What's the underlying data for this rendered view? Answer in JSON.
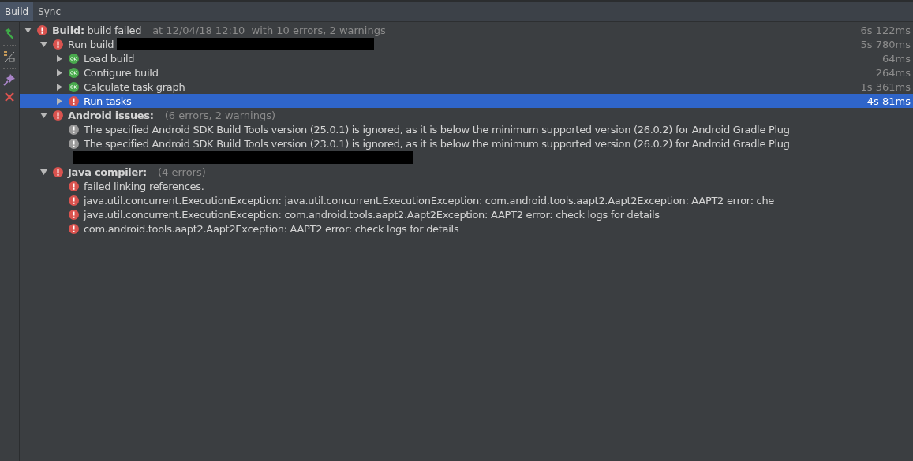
{
  "tabs": [
    {
      "label": "Build",
      "selected": true
    },
    {
      "label": "Sync",
      "selected": false
    }
  ],
  "tree": [
    {
      "label": "**Build:** build failed",
      "detail": "at 12/04/18 12:10  with 10 errors, 2 warnings",
      "kind": "error",
      "expanded": true,
      "selected": false,
      "time": "6s 122ms",
      "children": [
        {
          "label": "Run build",
          "kind": "error",
          "expanded": true,
          "selected": false,
          "redacted": true,
          "time": "5s 780ms",
          "children": [
            {
              "label": "Load build",
              "kind": "ok",
              "expanded": false,
              "selected": false,
              "time": "64ms"
            },
            {
              "label": "Configure build",
              "kind": "ok",
              "expanded": false,
              "selected": false,
              "time": "264ms"
            },
            {
              "label": "Calculate task graph",
              "kind": "ok",
              "expanded": false,
              "selected": false,
              "time": "1s 361ms"
            },
            {
              "label": "Run tasks",
              "kind": "error",
              "expanded": false,
              "selected": true,
              "time": "4s 81ms"
            }
          ]
        },
        {
          "label": "Android issues:",
          "bold": true,
          "detail": "(6 errors, 2 warnings)",
          "kind": "error",
          "expanded": true,
          "selected": false,
          "children": [
            {
              "label": "The specified Android SDK Build Tools version (25.0.1) is ignored, as it is below the minimum supported version (26.0.2) for Android Gradle Plug",
              "kind": "warning",
              "selected": false
            },
            {
              "label": "The specified Android SDK Build Tools version (23.0.1) is ignored, as it is below the minimum supported version (26.0.2) for Android Gradle Plug",
              "kind": "warning",
              "selected": false
            },
            {
              "kind": "redacted",
              "selected": false
            }
          ]
        },
        {
          "label": "Java compiler:",
          "bold": true,
          "detail": "(4 errors)",
          "kind": "error",
          "expanded": true,
          "selected": false,
          "children": [
            {
              "label": "failed linking references.",
              "kind": "error",
              "selected": false
            },
            {
              "label": "java.util.concurrent.ExecutionException: java.util.concurrent.ExecutionException: com.android.tools.aapt2.Aapt2Exception: AAPT2 error: che",
              "kind": "error",
              "selected": false
            },
            {
              "label": "java.util.concurrent.ExecutionException: com.android.tools.aapt2.Aapt2Exception: AAPT2 error: check logs for details",
              "kind": "error",
              "selected": false
            },
            {
              "label": "com.android.tools.aapt2.Aapt2Exception: AAPT2 error: check logs for details",
              "kind": "error",
              "selected": false
            }
          ]
        }
      ]
    }
  ]
}
